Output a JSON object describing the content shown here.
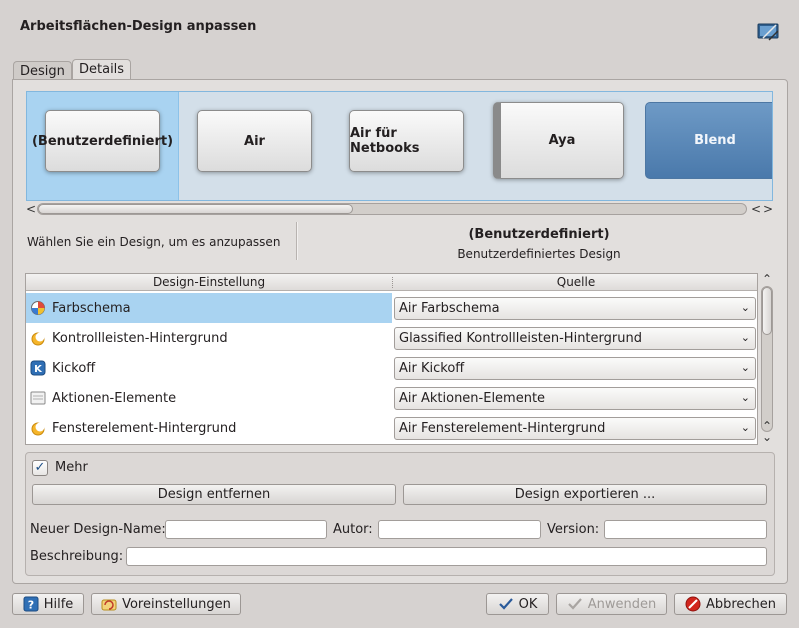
{
  "window": {
    "title": "Arbeitsflächen-Design anpassen"
  },
  "tabs": [
    {
      "label": "Design",
      "active": false
    },
    {
      "label": "Details",
      "active": true
    }
  ],
  "themes": [
    {
      "label": "(Benutzerdefiniert)",
      "selected": true
    },
    {
      "label": "Air",
      "selected": false
    },
    {
      "label": "Air für Netbooks",
      "selected": false
    },
    {
      "label": "Aya",
      "selected": false
    },
    {
      "label": "Blend",
      "selected": false
    }
  ],
  "hint": "Wählen Sie ein Design, um es anzupassen",
  "selected_theme": {
    "name": "(Benutzerdefiniert)",
    "description": "Benutzerdefiniertes Design"
  },
  "table": {
    "columns": [
      "Design-Einstellung",
      "Quelle"
    ],
    "rows": [
      {
        "setting": "Farbschema",
        "source": "Air Farbschema",
        "icon": "color-scheme-icon",
        "selected": true
      },
      {
        "setting": "Kontrollleisten-Hintergrund",
        "source": "Glassified Kontrollleisten-Hintergrund",
        "icon": "panel-background-icon",
        "selected": false
      },
      {
        "setting": "Kickoff",
        "source": "Air Kickoff",
        "icon": "kickoff-icon",
        "selected": false
      },
      {
        "setting": "Aktionen-Elemente",
        "source": "Air Aktionen-Elemente",
        "icon": "action-elements-icon",
        "selected": false
      },
      {
        "setting": "Fensterelement-Hintergrund",
        "source": "Air Fensterelement-Hintergrund",
        "icon": "widget-background-icon",
        "selected": false
      }
    ]
  },
  "more": {
    "checkbox_label": "Mehr",
    "checked": true,
    "remove_button": "Design entfernen",
    "export_button": "Design exportieren ...",
    "new_name_label": "Neuer Design-Name:",
    "author_label": "Autor:",
    "version_label": "Version:",
    "description_label": "Beschreibung:",
    "new_name_value": "",
    "author_value": "",
    "version_value": "",
    "description_value": ""
  },
  "footer": {
    "help": "Hilfe",
    "defaults": "Voreinstellungen",
    "ok": "OK",
    "apply": "Anwenden",
    "cancel": "Abbrechen"
  },
  "colors": {
    "selection": "#a9d3f1",
    "blend_card": "#5a87b8",
    "window_bg": "#d6d2d0"
  }
}
